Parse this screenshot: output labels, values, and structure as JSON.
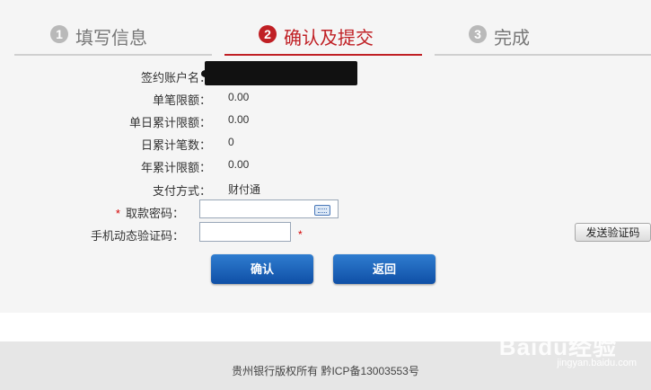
{
  "steps": [
    {
      "num": "1",
      "label": "填写信息"
    },
    {
      "num": "2",
      "label": "确认及提交"
    },
    {
      "num": "3",
      "label": "完成"
    }
  ],
  "form": {
    "account_name_label": "签约账户名：",
    "single_limit_label": "单笔限额：",
    "single_limit_value": "0.00",
    "daily_limit_label": "单日累计限额：",
    "daily_limit_value": "0.00",
    "daily_count_label": "日累计笔数：",
    "daily_count_value": "0",
    "yearly_limit_label": "年累计限额：",
    "yearly_limit_value": "0.00",
    "payment_method_label": "支付方式：",
    "payment_method_value": "财付通",
    "required_mark": "*",
    "withdraw_password_label": "取款密码：",
    "sms_code_label": "手机动态验证码：",
    "send_code_button": "发送验证码"
  },
  "buttons": {
    "confirm": "确认",
    "back": "返回"
  },
  "footer": {
    "copyright": "贵州银行版权所有 黔ICP备13003553号"
  },
  "watermark": {
    "brand": "Baidu经验",
    "url": "jingyan.baidu.com"
  },
  "colors": {
    "active_step": "#c01f24",
    "button_blue": "#1a5fb4"
  }
}
